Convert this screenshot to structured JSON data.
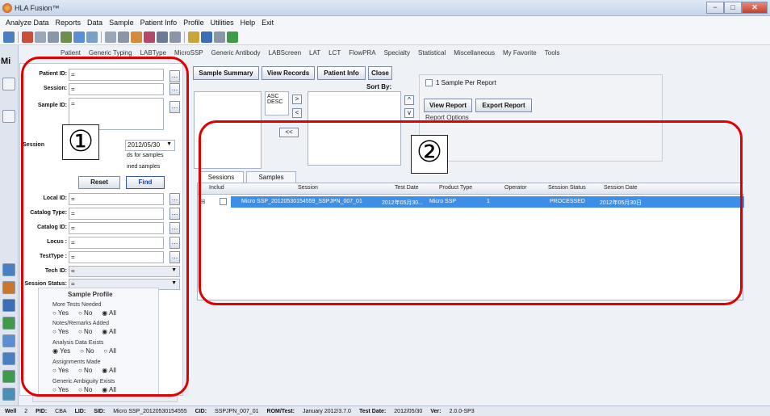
{
  "window": {
    "title": "HLA Fusion™"
  },
  "menu": [
    "Analyze Data",
    "Reports",
    "Data",
    "Sample",
    "Patient Info",
    "Profile",
    "Utilities",
    "Help",
    "Exit"
  ],
  "nav_tabs": [
    "Patient",
    "Generic Typing",
    "LABType",
    "MicroSSP",
    "Generic Antibody",
    "LABScreen",
    "LAT",
    "LCT",
    "FlowPRA",
    "Specialty",
    "Statistical",
    "Miscellaneous",
    "My Favorite",
    "Tools"
  ],
  "left_label": "Mi",
  "filters": {
    "patient_id": {
      "label": "Patient ID:",
      "value": "="
    },
    "session": {
      "label": "Session:",
      "value": "="
    },
    "sample_id": {
      "label": "Sample ID:",
      "value": "="
    },
    "session_date": {
      "label": "Session",
      "value": "2012/05/30"
    },
    "hint1": "ds for samples",
    "hint2": "ined samples",
    "reset_label": "Reset",
    "find_label": "Find",
    "local_id": {
      "label": "Local ID:",
      "value": "="
    },
    "catalog_type": {
      "label": "Catalog Type:",
      "value": "="
    },
    "catalog_id": {
      "label": "Catalog ID:",
      "value": "="
    },
    "locus": {
      "label": "Locus :",
      "value": "="
    },
    "test_type": {
      "label": "TestType :",
      "value": "="
    },
    "tech_id": {
      "label": "Tech ID:",
      "value": "="
    },
    "session_status": {
      "label": "Session Status:",
      "value": "="
    }
  },
  "sample_profile": {
    "title": "Sample Profile",
    "q1": "More Tests Needed",
    "q2": "Notes/Remarks Added",
    "q3": "Analysis Data Exists",
    "q4": "Assignments Made",
    "q5": "Generic Ambiguity Exists",
    "yes": "Yes",
    "no": "No",
    "all": "All"
  },
  "actions": {
    "sample_summary": "Sample Summary",
    "view_records": "View Records",
    "patient_info": "Patient Info",
    "close": "Close"
  },
  "sort": {
    "label": "Sort By:",
    "asc": "ASC",
    "desc": "DESC",
    "right": ">",
    "left": "<",
    "all_left": "<<",
    "up": "^",
    "down": "v"
  },
  "report": {
    "one_per": "1 Sample Per Report",
    "view": "View Report",
    "export": "Export Report",
    "options": "Report Options"
  },
  "tabs": {
    "sessions": "Sessions",
    "samples": "Samples"
  },
  "grid": {
    "headers": [
      "Includ",
      "Session",
      "Test Date",
      "Product Type",
      "Operator",
      "Session Status",
      "Session Date"
    ],
    "row": {
      "session": "Micro SSP_20120530154559_SSPJPN_007_01",
      "test_date": "2012年05月30...",
      "product": "Micro SSP",
      "operator": "1",
      "status": "PROCESSED",
      "session_date": "2012年05月30日"
    }
  },
  "annotations": {
    "one": "①",
    "two": "②"
  },
  "status_bar": {
    "well_label": "Well",
    "well": "2",
    "pid_label": "PID:",
    "pid": "CBA",
    "lid_label": "LID:",
    "sid_label": "SID:",
    "sid": "Micro SSP_20120530154555",
    "cid_label": "CID:",
    "cid": "SSPJPN_007_01",
    "rom_label": "ROM/Test:",
    "rom": "January 2012/3.7.0",
    "test_date_label": "Test Date:",
    "test_date": "2012/05/30",
    "ver_label": "Ver:",
    "ver": "2.0.0-SP3"
  },
  "colors": {
    "selected_row": "#3d8ee6",
    "annotation": "#e00000",
    "find_text": "#1a3fbf"
  }
}
